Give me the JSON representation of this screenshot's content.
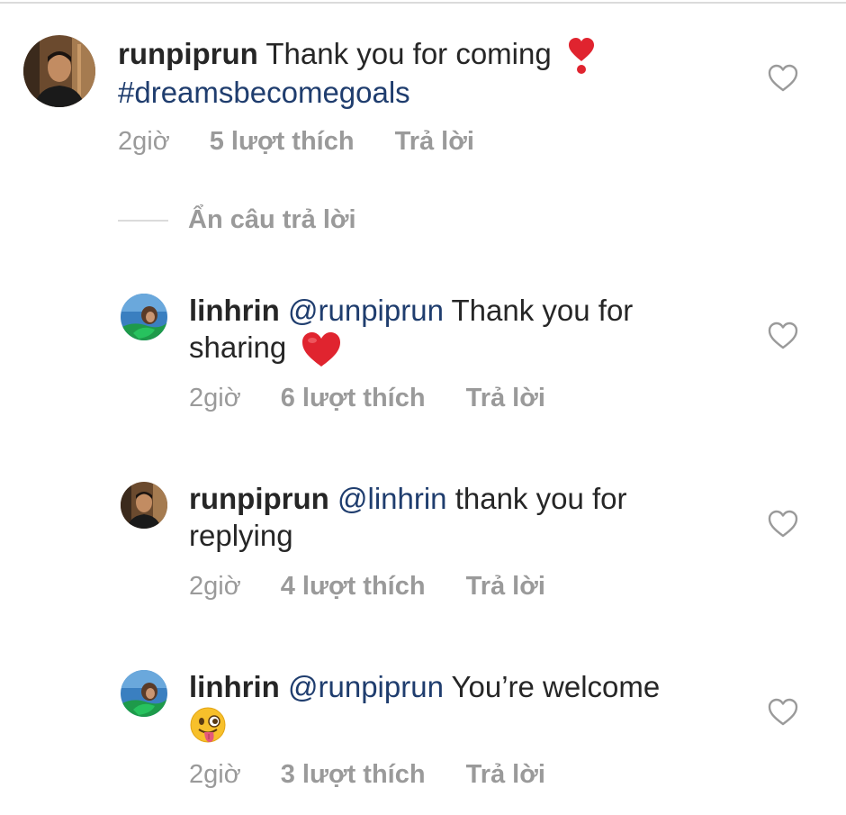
{
  "comments": [
    {
      "username": "runpiprun",
      "text": "Thank you for coming",
      "emoji": "heart-exclamation",
      "hashtag": "#dreamsbecomegoals",
      "time": "2giờ",
      "likes": "5 lượt thích",
      "reply": "Trả lời"
    },
    {
      "username": "linhrin",
      "mention": "@runpiprun",
      "text_a": "Thank you for",
      "text_b": "sharing",
      "emoji": "red-heart",
      "time": "2giờ",
      "likes": "6 lượt thích",
      "reply": "Trả lời"
    },
    {
      "username": "runpiprun",
      "mention": "@linhrin",
      "text_a": "thank you for",
      "text_b": "replying",
      "time": "2giờ",
      "likes": "4 lượt thích",
      "reply": "Trả lời"
    },
    {
      "username": "linhrin",
      "mention": "@runpiprun",
      "text": "You’re welcome",
      "emoji": "winking-face-with-tongue",
      "time": "2giờ",
      "likes": "3 lượt thích",
      "reply": "Trả lời"
    }
  ],
  "hide_replies_label": "Ẩn câu trả lời",
  "colors": {
    "text": "#262626",
    "link": "#1f3d6e",
    "meta": "#9a9a9a",
    "divider": "#dbdbdb"
  }
}
